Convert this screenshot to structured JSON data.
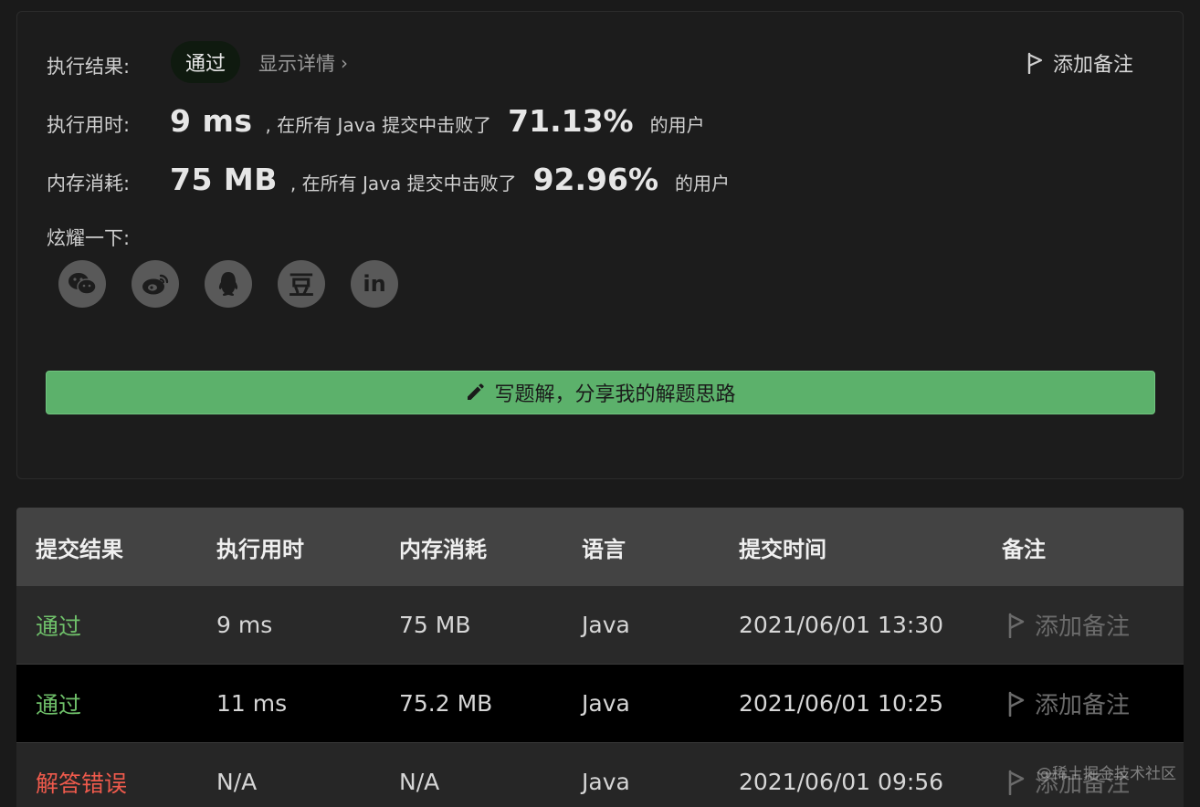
{
  "result": {
    "label": "执行结果:",
    "status": "通过",
    "detail_link": "显示详情",
    "add_note": "添加备注",
    "time": {
      "label": "执行用时:",
      "value": "9 ms",
      "text": ", 在所有 Java 提交中击败了",
      "percent": "71.13%",
      "suffix": "的用户"
    },
    "memory": {
      "label": "内存消耗:",
      "value": "75 MB",
      "text": ", 在所有 Java 提交中击败了",
      "percent": "92.96%",
      "suffix": "的用户"
    },
    "share_label": "炫耀一下:",
    "share_icons": [
      "wechat-icon",
      "weibo-icon",
      "qq-icon",
      "douban-icon",
      "linkedin-icon"
    ],
    "douban_glyph": "豆",
    "linkedin_glyph": "in",
    "write_solution": "写题解，分享我的解题思路"
  },
  "table": {
    "headers": [
      "提交结果",
      "执行用时",
      "内存消耗",
      "语言",
      "提交时间",
      "备注"
    ],
    "rows": [
      {
        "status": "通过",
        "time": "9 ms",
        "memory": "75 MB",
        "lang": "Java",
        "submitted": "2021/06/01 13:30",
        "note": "添加备注"
      },
      {
        "status": "通过",
        "time": "11 ms",
        "memory": "75.2 MB",
        "lang": "Java",
        "submitted": "2021/06/01 10:25",
        "note": "添加备注"
      },
      {
        "status": "解答错误",
        "time": "N/A",
        "memory": "N/A",
        "lang": "Java",
        "submitted": "2021/06/01 09:56",
        "note": "添加备注"
      }
    ]
  },
  "watermark": "@稀土掘金技术社区",
  "colors": {
    "accent_green": "#5cb16b",
    "pass_green": "#6fc06a",
    "error_red": "#ee5a4c"
  }
}
